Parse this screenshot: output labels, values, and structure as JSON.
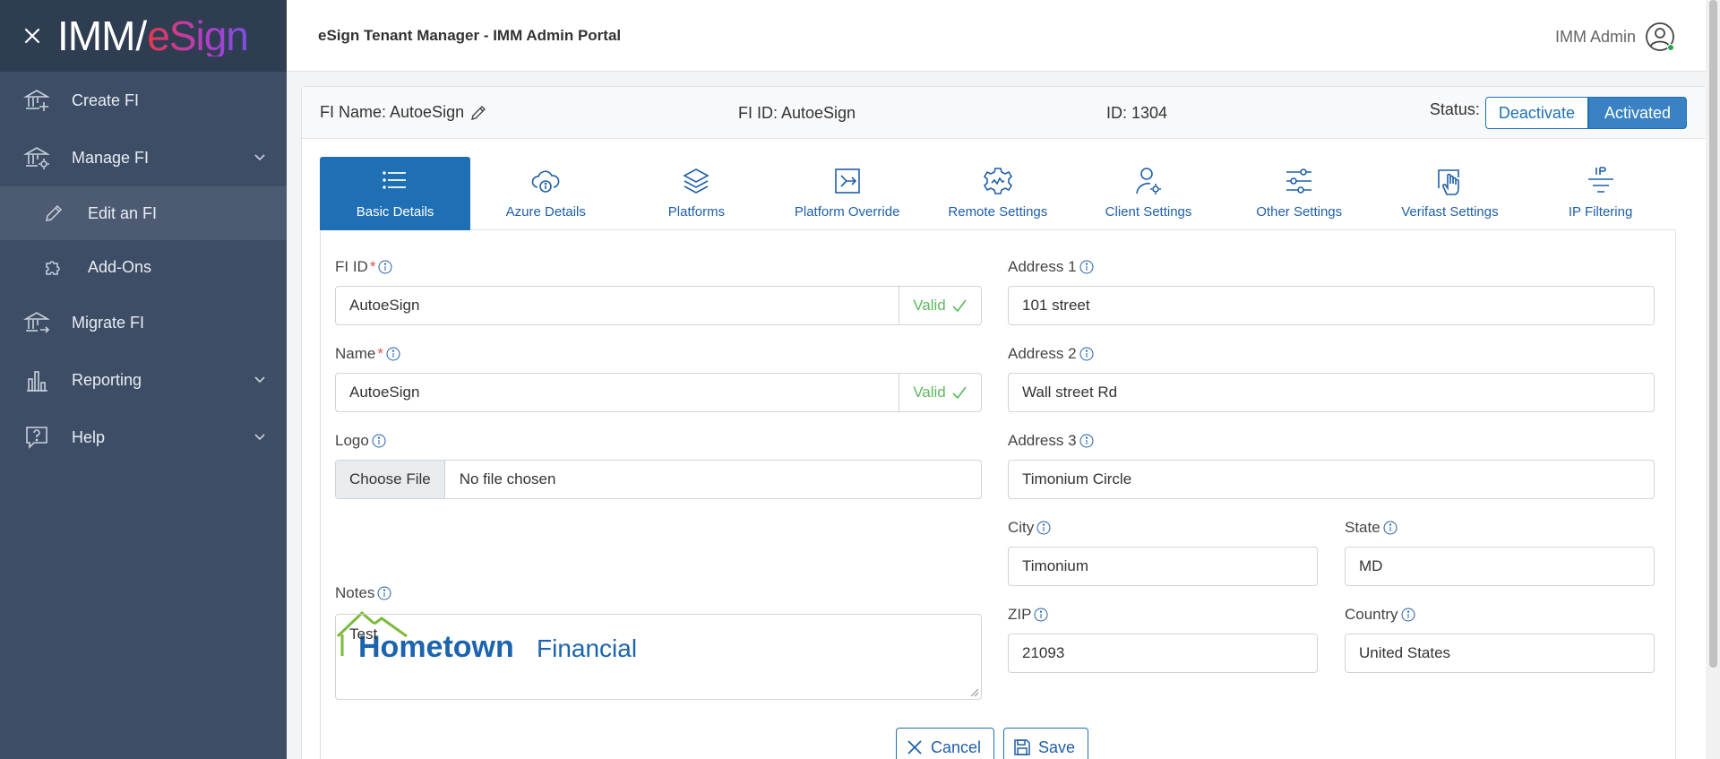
{
  "brand": {
    "imm": "IMM",
    "slash": "/",
    "esign": "eSign"
  },
  "sidebar": {
    "items": [
      {
        "label": "Create FI"
      },
      {
        "label": "Manage FI"
      },
      {
        "label": "Edit an FI"
      },
      {
        "label": "Add-Ons"
      },
      {
        "label": "Migrate FI"
      },
      {
        "label": "Reporting"
      },
      {
        "label": "Help"
      }
    ]
  },
  "header": {
    "title": "eSign Tenant Manager - IMM Admin Portal",
    "user": "IMM Admin"
  },
  "fi": {
    "name_text": "FI Name: AutoeSign",
    "id_text": "FI ID: AutoeSign",
    "rec_id_text": "ID: 1304",
    "status_label": "Status:",
    "deactivate": "Deactivate",
    "activated": "Activated"
  },
  "tabs": [
    {
      "label": "Basic Details",
      "icon": "list-icon",
      "active": true
    },
    {
      "label": "Azure Details",
      "icon": "cloud-info-icon"
    },
    {
      "label": "Platforms",
      "icon": "layers-icon"
    },
    {
      "label": "Platform Override",
      "icon": "override-icon"
    },
    {
      "label": "Remote Settings",
      "icon": "remote-settings-icon"
    },
    {
      "label": "Client Settings",
      "icon": "client-settings-icon"
    },
    {
      "label": "Other Settings",
      "icon": "sliders-icon"
    },
    {
      "label": "Verifast Settings",
      "icon": "hand-scan-icon"
    },
    {
      "label": "IP Filtering",
      "icon": "ip-filter-icon"
    }
  ],
  "form": {
    "fi_id": {
      "label": "FI ID",
      "required": "*",
      "value": "AutoeSign",
      "valid": "Valid"
    },
    "name": {
      "label": "Name",
      "required": "*",
      "value": "AutoeSign",
      "valid": "Valid"
    },
    "logo": {
      "label": "Logo",
      "choose": "Choose File",
      "file": "No file chosen",
      "image_text": "Hometown Financial"
    },
    "notes": {
      "label": "Notes",
      "value": "Test"
    },
    "address1": {
      "label": "Address 1",
      "value": "101 street"
    },
    "address2": {
      "label": "Address 2",
      "value": "Wall street Rd"
    },
    "address3": {
      "label": "Address 3",
      "value": "Timonium Circle"
    },
    "city": {
      "label": "City",
      "value": "Timonium"
    },
    "state": {
      "label": "State",
      "value": "MD"
    },
    "zip": {
      "label": "ZIP",
      "value": "21093"
    },
    "country": {
      "label": "Country",
      "value": "United States"
    }
  },
  "actions": {
    "cancel": "Cancel",
    "save": "Save"
  },
  "colors": {
    "sidebar": "#3d4d66",
    "brand_bar": "#2f3d52",
    "primary": "#1f6fb5",
    "valid": "#5cb85c"
  }
}
